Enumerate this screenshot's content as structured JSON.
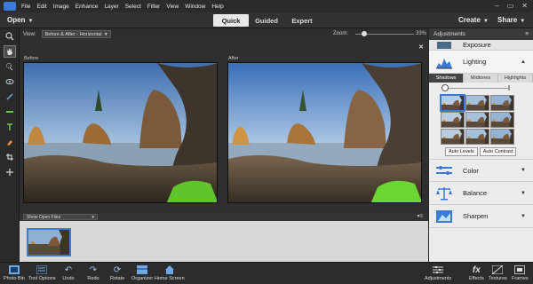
{
  "menubar": {
    "items": [
      "File",
      "Edit",
      "Image",
      "Enhance",
      "Layer",
      "Select",
      "Filter",
      "View",
      "Window",
      "Help"
    ],
    "window_controls": [
      "–",
      "▭",
      "✕"
    ]
  },
  "modebar": {
    "open": "Open",
    "tabs": [
      "Quick",
      "Guided",
      "Expert"
    ],
    "active_tab": "Quick",
    "create": "Create",
    "share": "Share"
  },
  "tools": [
    "zoom-icon",
    "hand-icon",
    "quick-selection-icon",
    "red-eye-icon",
    "whiten-teeth-icon",
    "straighten-icon",
    "type-icon",
    "spot-healing-icon",
    "crop-icon",
    "move-icon"
  ],
  "options": {
    "view_label": "View:",
    "view_value": "Before & After - Horizontal",
    "zoom_label": "Zoom:",
    "zoom_value": "33%",
    "zoom_fraction": 0.33
  },
  "canvas": {
    "before_label": "Before",
    "after_label": "After",
    "close": "✕"
  },
  "bin": {
    "show_label": "Show Open Files",
    "menu": "▾≡"
  },
  "panel": {
    "title": "Adjustments",
    "exposure": "Exposure",
    "lighting": "Lighting",
    "subtabs": [
      "Shadows",
      "Midtones",
      "Highlights"
    ],
    "active_subtab": "Shadows",
    "auto_levels": "Auto Levels",
    "auto_contrast": "Auto Contrast",
    "color": "Color",
    "balance": "Balance",
    "sharpen": "Sharpen"
  },
  "bottom": {
    "left": [
      "Photo Bin",
      "Tool Options",
      "Undo",
      "Redo",
      "Rotate",
      "Organizer",
      "Home Screen"
    ],
    "right": [
      "Adjustments",
      "Effects",
      "Textures",
      "Frames"
    ]
  },
  "colors": {
    "accent": "#3a7bd5",
    "sky": "#9db9d8",
    "rock": "#4a3a2c",
    "moss": "#5fc52a"
  }
}
